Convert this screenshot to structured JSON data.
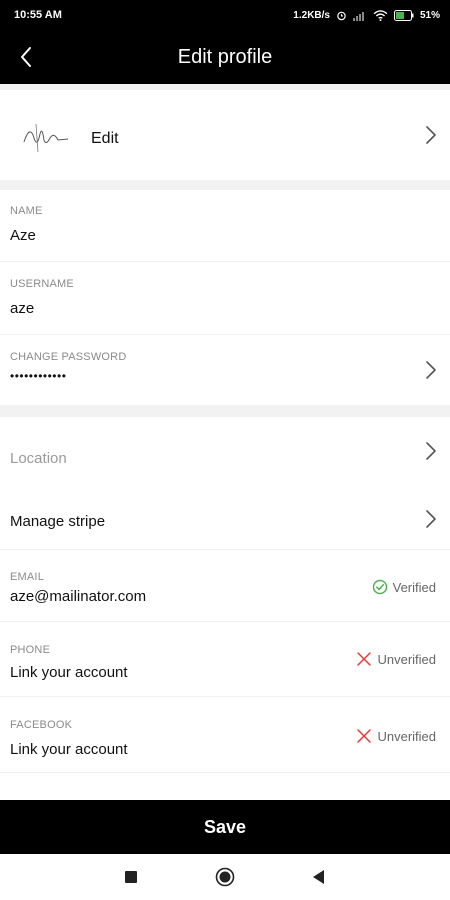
{
  "status_bar": {
    "time": "10:55 AM",
    "network_speed": "1.2KB/s",
    "battery": "51%",
    "icons": [
      "alarm-icon",
      "signal-icon",
      "wifi-icon",
      "battery-icon"
    ]
  },
  "header": {
    "title": "Edit profile",
    "back_icon": "back-arrow-icon"
  },
  "profile": {
    "edit_label": "Edit",
    "avatar_icon": "signature-avatar-icon"
  },
  "fields": {
    "name": {
      "label": "NAME",
      "value": "Aze"
    },
    "username": {
      "label": "USERNAME",
      "value": "aze"
    },
    "password": {
      "label": "CHANGE PASSWORD",
      "value": "••••••••••••"
    }
  },
  "links": {
    "location": "Location",
    "stripe": "Manage stripe"
  },
  "accounts": {
    "email": {
      "label": "EMAIL",
      "value": "aze@mailinator.com",
      "status": "Verified"
    },
    "phone": {
      "label": "PHONE",
      "value": "Link your account",
      "status": "Unverified"
    },
    "facebook": {
      "label": "FACEBOOK",
      "value": "Link your account",
      "status": "Unverified"
    }
  },
  "save_label": "Save",
  "colors": {
    "verified": "#4caf50",
    "unverified": "#e53935",
    "bar": "#000000"
  }
}
